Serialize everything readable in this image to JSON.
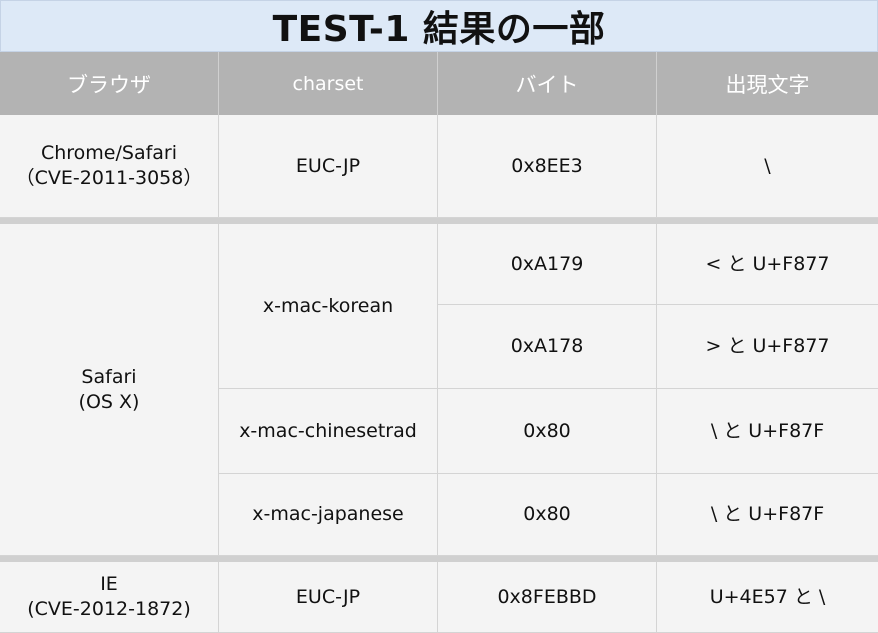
{
  "title": "TEST-1 結果の一部",
  "headers": {
    "browser": "ブラウザ",
    "charset": "charset",
    "byte": "バイト",
    "chars": "出現文字"
  },
  "rows": {
    "chrome": {
      "browser_line1": "Chrome/Safari",
      "browser_line2": "（CVE-2011-3058）",
      "charset": "EUC-JP",
      "byte": "0x8EE3",
      "chars": "\\"
    },
    "safari": {
      "browser_line1": "Safari",
      "browser_line2": "(OS X)",
      "korean_charset": "x-mac-korean",
      "korean_byte_1": "0xA179",
      "korean_chars_1": "< と U+F877",
      "korean_byte_2": "0xA178",
      "korean_chars_2": "> と U+F877",
      "chinesetrad_charset": "x-mac-chinesetrad",
      "chinesetrad_byte": "0x80",
      "chinesetrad_chars": "\\ と U+F87F",
      "japanese_charset": "x-mac-japanese",
      "japanese_byte": "0x80",
      "japanese_chars": "\\ と U+F87F"
    },
    "ie": {
      "browser_line1": "IE",
      "browser_line2": "(CVE-2012-1872)",
      "charset": "EUC-JP",
      "byte": "0x8FEBBD",
      "chars": "U+4E57 と \\"
    }
  }
}
